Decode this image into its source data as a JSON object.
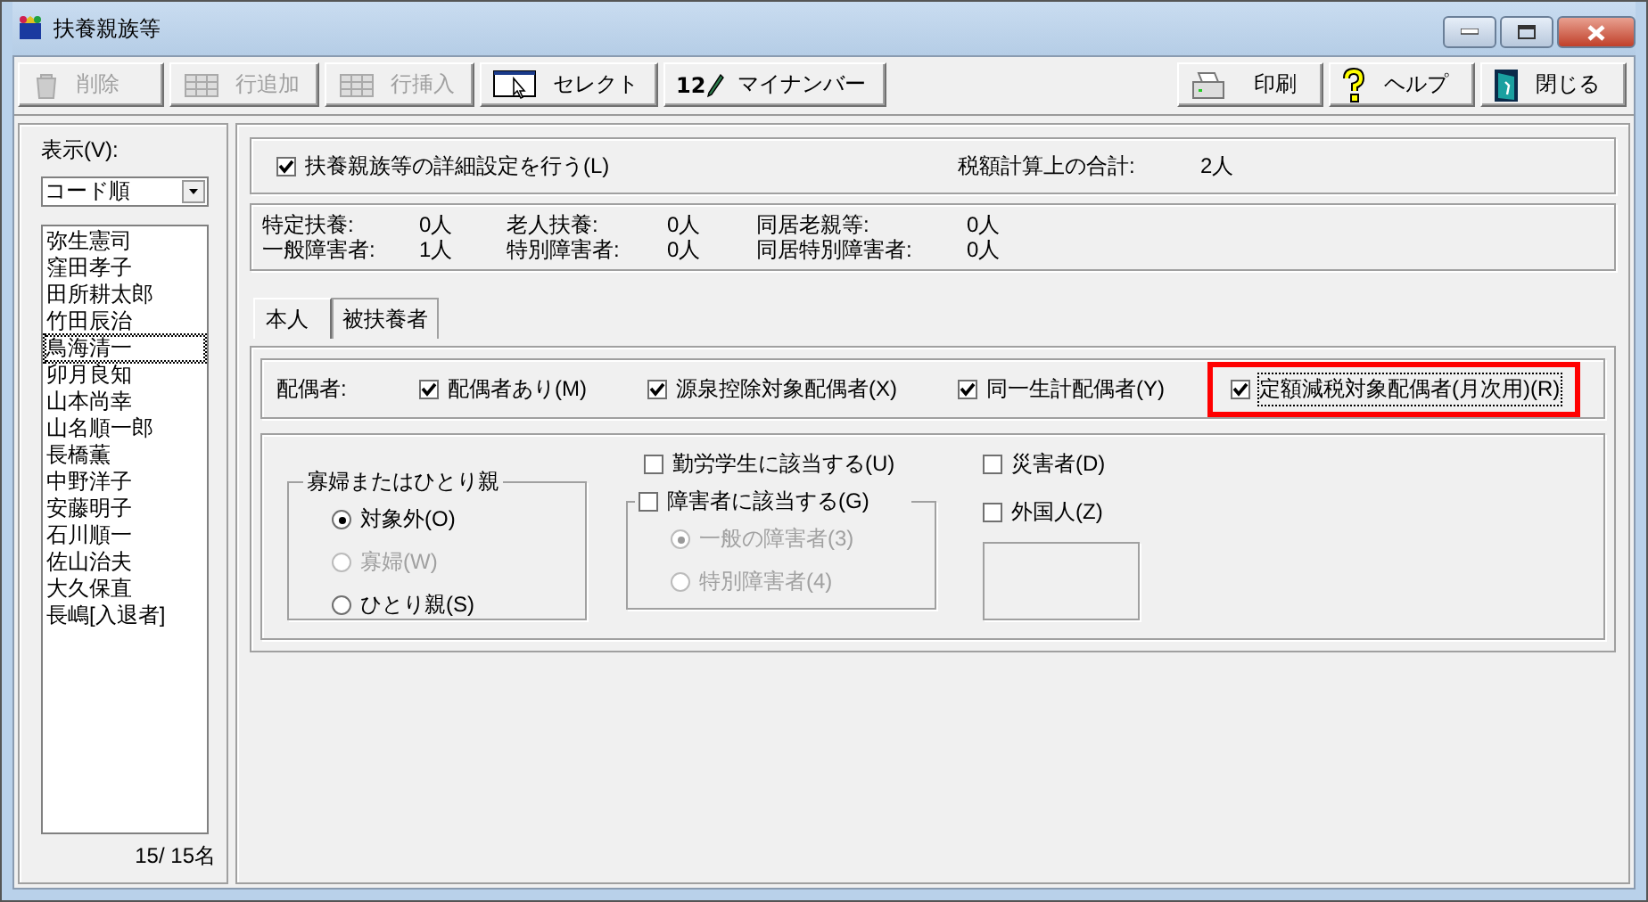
{
  "window": {
    "title": "扶養親族等"
  },
  "toolbar": [
    {
      "label": "削除",
      "disabled": true
    },
    {
      "label": "行追加",
      "disabled": true
    },
    {
      "label": "行挿入",
      "disabled": true
    },
    {
      "label": "セレクト",
      "disabled": false
    },
    {
      "label": "マイナンバー",
      "badge": "12",
      "disabled": false
    }
  ],
  "toolbar_right": [
    {
      "label": "印刷"
    },
    {
      "label": "ヘルプ"
    },
    {
      "label": "閉じる"
    }
  ],
  "sidebar": {
    "view_label": "表示(V):",
    "sort": "コード順",
    "items": [
      {
        "name": "弥生憲司",
        "focused": false
      },
      {
        "name": "窪田孝子",
        "focused": false
      },
      {
        "name": "田所耕太郎",
        "focused": false
      },
      {
        "name": "竹田辰治",
        "focused": false
      },
      {
        "name": "鳥海清一",
        "focused": true
      },
      {
        "name": "卯月良知",
        "focused": false
      },
      {
        "name": "山本尚幸",
        "focused": false
      },
      {
        "name": "山名順一郎",
        "focused": false
      },
      {
        "name": "長橋薫",
        "focused": false
      },
      {
        "name": "中野洋子",
        "focused": false
      },
      {
        "name": "安藤明子",
        "focused": false
      },
      {
        "name": "石川順一",
        "focused": false
      },
      {
        "name": "佐山治夫",
        "focused": false
      },
      {
        "name": "大久保直",
        "focused": false
      },
      {
        "name": "長嶋[入退者]",
        "focused": false
      }
    ],
    "count": "15/  15名"
  },
  "detail_setting": {
    "label": "扶養親族等の詳細設定を行う(L)",
    "checked": true
  },
  "total": {
    "label": "税額計算上の合計:",
    "value": "2人"
  },
  "summary": [
    {
      "label": "特定扶養:",
      "value": "0人"
    },
    {
      "label": "老人扶養:",
      "value": "0人"
    },
    {
      "label": "同居老親等:",
      "value": "0人"
    },
    {
      "label": "一般障害者:",
      "value": "1人"
    },
    {
      "label": "特別障害者:",
      "value": "0人"
    },
    {
      "label": "同居特別障害者:",
      "value": "0人"
    }
  ],
  "tabs": [
    {
      "label": "本人",
      "selected": true
    },
    {
      "label": "被扶養者",
      "selected": false
    }
  ],
  "spouse": {
    "label": "配偶者:",
    "options": [
      {
        "label": "配偶者あり(M)",
        "checked": true,
        "highlighted": false,
        "focused": false
      },
      {
        "label": "源泉控除対象配偶者(X)",
        "checked": true,
        "highlighted": false,
        "focused": false
      },
      {
        "label": "同一生計配偶者(Y)",
        "checked": true,
        "highlighted": false,
        "focused": false
      },
      {
        "label": "定額減税対象配偶者(月次用)(R)",
        "checked": true,
        "highlighted": true,
        "focused": true
      }
    ]
  },
  "widow_group": {
    "title": "寡婦またはひとり親",
    "options": [
      {
        "label": "対象外(O)",
        "selected": true,
        "disabled": false
      },
      {
        "label": "寡婦(W)",
        "selected": false,
        "disabled": true
      },
      {
        "label": "ひとり親(S)",
        "selected": false,
        "disabled": false
      }
    ]
  },
  "student": {
    "label": "勤労学生に該当する(U)",
    "checked": false
  },
  "disability": {
    "label": "障害者に該当する(G)",
    "checked": false,
    "options": [
      {
        "label": "一般の障害者(3)",
        "selected": true,
        "disabled": true
      },
      {
        "label": "特別障害者(4)",
        "selected": false,
        "disabled": true
      }
    ]
  },
  "other_checks": [
    {
      "label": "災害者(D)",
      "checked": false
    },
    {
      "label": "外国人(Z)",
      "checked": false
    }
  ]
}
